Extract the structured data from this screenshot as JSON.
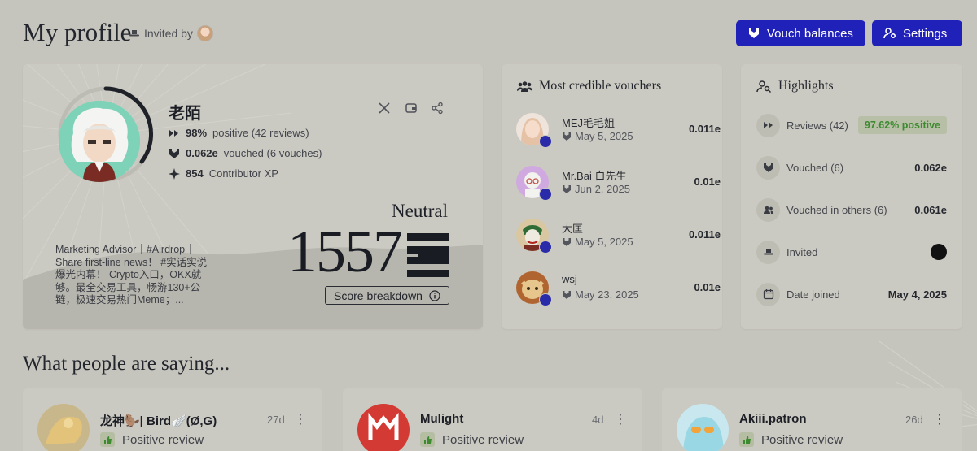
{
  "header": {
    "title": "My profile",
    "invited_by": "Invited by",
    "vouch_balances": "Vouch balances",
    "settings": "Settings"
  },
  "profile": {
    "name": "老陌",
    "positive": "98%",
    "positive_rest": "positive (42 reviews)",
    "vouched": "0.062e",
    "vouched_rest": "vouched (6 vouches)",
    "xp": "854",
    "xp_rest": "Contributor XP",
    "bio": "Marketing Advisor｜#Airdrop｜Share first-line news！ #实话实说 爆光内幕！ Crypto入口，OKX就够。最全交易工具，畅游130+公链，极速交易热门Meme；...",
    "score_label": "Neutral",
    "score": "1557",
    "score_breakdown": "Score breakdown"
  },
  "vouchers": {
    "title": "Most credible vouchers",
    "items": [
      {
        "name": "MEJ毛毛姐",
        "date": "May 5, 2025",
        "amount": "0.011e"
      },
      {
        "name": "Mr.Bai 白先生",
        "date": "Jun 2, 2025",
        "amount": "0.01e"
      },
      {
        "name": "大匡",
        "date": "May 5, 2025",
        "amount": "0.011e"
      },
      {
        "name": "wsj",
        "date": "May 23, 2025",
        "amount": "0.01e"
      }
    ]
  },
  "highlights": {
    "title": "Highlights",
    "rows": [
      {
        "label": "Reviews (42)",
        "value": "97.62% positive"
      },
      {
        "label": "Vouched (6)",
        "value": "0.062e"
      },
      {
        "label": "Vouched in others (6)",
        "value": "0.061e"
      },
      {
        "label": "Invited",
        "value": ""
      },
      {
        "label": "Date joined",
        "value": "May 4, 2025"
      }
    ]
  },
  "reviews": {
    "title": "What people are saying...",
    "items": [
      {
        "name": "龙神🦫| Bird🪽(Ø,G)",
        "time": "27d",
        "tag": "Positive review"
      },
      {
        "name": "Mulight",
        "time": "4d",
        "tag": "Positive review"
      },
      {
        "name": "Akiii.patron",
        "time": "26d",
        "tag": "Positive review"
      }
    ]
  },
  "colors": {
    "background": "#c6c5bd",
    "card": "#cbcac2",
    "primary_button": "#2021b8",
    "positive_green": "#3d8a30"
  }
}
